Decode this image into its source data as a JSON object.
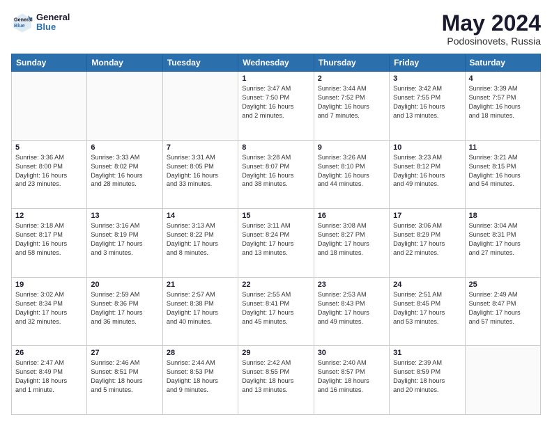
{
  "header": {
    "logo_general": "General",
    "logo_blue": "Blue",
    "month_year": "May 2024",
    "location": "Podosinovets, Russia"
  },
  "days_of_week": [
    "Sunday",
    "Monday",
    "Tuesday",
    "Wednesday",
    "Thursday",
    "Friday",
    "Saturday"
  ],
  "weeks": [
    [
      {
        "day": "",
        "info": ""
      },
      {
        "day": "",
        "info": ""
      },
      {
        "day": "",
        "info": ""
      },
      {
        "day": "1",
        "info": "Sunrise: 3:47 AM\nSunset: 7:50 PM\nDaylight: 16 hours\nand 2 minutes."
      },
      {
        "day": "2",
        "info": "Sunrise: 3:44 AM\nSunset: 7:52 PM\nDaylight: 16 hours\nand 7 minutes."
      },
      {
        "day": "3",
        "info": "Sunrise: 3:42 AM\nSunset: 7:55 PM\nDaylight: 16 hours\nand 13 minutes."
      },
      {
        "day": "4",
        "info": "Sunrise: 3:39 AM\nSunset: 7:57 PM\nDaylight: 16 hours\nand 18 minutes."
      }
    ],
    [
      {
        "day": "5",
        "info": "Sunrise: 3:36 AM\nSunset: 8:00 PM\nDaylight: 16 hours\nand 23 minutes."
      },
      {
        "day": "6",
        "info": "Sunrise: 3:33 AM\nSunset: 8:02 PM\nDaylight: 16 hours\nand 28 minutes."
      },
      {
        "day": "7",
        "info": "Sunrise: 3:31 AM\nSunset: 8:05 PM\nDaylight: 16 hours\nand 33 minutes."
      },
      {
        "day": "8",
        "info": "Sunrise: 3:28 AM\nSunset: 8:07 PM\nDaylight: 16 hours\nand 38 minutes."
      },
      {
        "day": "9",
        "info": "Sunrise: 3:26 AM\nSunset: 8:10 PM\nDaylight: 16 hours\nand 44 minutes."
      },
      {
        "day": "10",
        "info": "Sunrise: 3:23 AM\nSunset: 8:12 PM\nDaylight: 16 hours\nand 49 minutes."
      },
      {
        "day": "11",
        "info": "Sunrise: 3:21 AM\nSunset: 8:15 PM\nDaylight: 16 hours\nand 54 minutes."
      }
    ],
    [
      {
        "day": "12",
        "info": "Sunrise: 3:18 AM\nSunset: 8:17 PM\nDaylight: 16 hours\nand 58 minutes."
      },
      {
        "day": "13",
        "info": "Sunrise: 3:16 AM\nSunset: 8:19 PM\nDaylight: 17 hours\nand 3 minutes."
      },
      {
        "day": "14",
        "info": "Sunrise: 3:13 AM\nSunset: 8:22 PM\nDaylight: 17 hours\nand 8 minutes."
      },
      {
        "day": "15",
        "info": "Sunrise: 3:11 AM\nSunset: 8:24 PM\nDaylight: 17 hours\nand 13 minutes."
      },
      {
        "day": "16",
        "info": "Sunrise: 3:08 AM\nSunset: 8:27 PM\nDaylight: 17 hours\nand 18 minutes."
      },
      {
        "day": "17",
        "info": "Sunrise: 3:06 AM\nSunset: 8:29 PM\nDaylight: 17 hours\nand 22 minutes."
      },
      {
        "day": "18",
        "info": "Sunrise: 3:04 AM\nSunset: 8:31 PM\nDaylight: 17 hours\nand 27 minutes."
      }
    ],
    [
      {
        "day": "19",
        "info": "Sunrise: 3:02 AM\nSunset: 8:34 PM\nDaylight: 17 hours\nand 32 minutes."
      },
      {
        "day": "20",
        "info": "Sunrise: 2:59 AM\nSunset: 8:36 PM\nDaylight: 17 hours\nand 36 minutes."
      },
      {
        "day": "21",
        "info": "Sunrise: 2:57 AM\nSunset: 8:38 PM\nDaylight: 17 hours\nand 40 minutes."
      },
      {
        "day": "22",
        "info": "Sunrise: 2:55 AM\nSunset: 8:41 PM\nDaylight: 17 hours\nand 45 minutes."
      },
      {
        "day": "23",
        "info": "Sunrise: 2:53 AM\nSunset: 8:43 PM\nDaylight: 17 hours\nand 49 minutes."
      },
      {
        "day": "24",
        "info": "Sunrise: 2:51 AM\nSunset: 8:45 PM\nDaylight: 17 hours\nand 53 minutes."
      },
      {
        "day": "25",
        "info": "Sunrise: 2:49 AM\nSunset: 8:47 PM\nDaylight: 17 hours\nand 57 minutes."
      }
    ],
    [
      {
        "day": "26",
        "info": "Sunrise: 2:47 AM\nSunset: 8:49 PM\nDaylight: 18 hours\nand 1 minute."
      },
      {
        "day": "27",
        "info": "Sunrise: 2:46 AM\nSunset: 8:51 PM\nDaylight: 18 hours\nand 5 minutes."
      },
      {
        "day": "28",
        "info": "Sunrise: 2:44 AM\nSunset: 8:53 PM\nDaylight: 18 hours\nand 9 minutes."
      },
      {
        "day": "29",
        "info": "Sunrise: 2:42 AM\nSunset: 8:55 PM\nDaylight: 18 hours\nand 13 minutes."
      },
      {
        "day": "30",
        "info": "Sunrise: 2:40 AM\nSunset: 8:57 PM\nDaylight: 18 hours\nand 16 minutes."
      },
      {
        "day": "31",
        "info": "Sunrise: 2:39 AM\nSunset: 8:59 PM\nDaylight: 18 hours\nand 20 minutes."
      },
      {
        "day": "",
        "info": ""
      }
    ]
  ]
}
